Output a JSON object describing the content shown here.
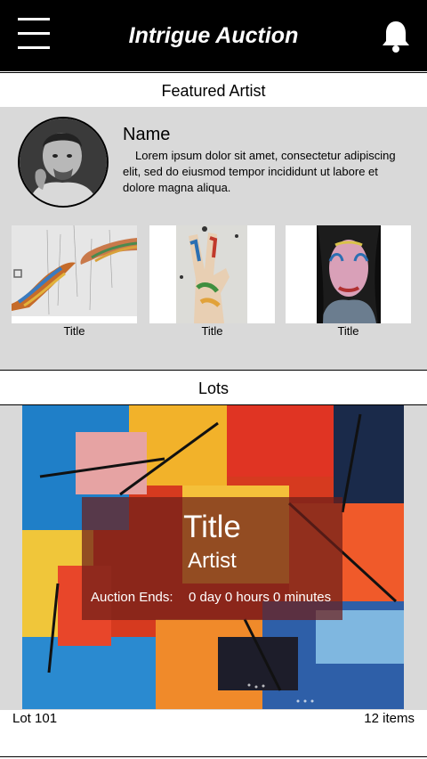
{
  "header": {
    "app_title": "Intrigue Auction",
    "menu_icon": "hamburger-menu-icon",
    "notification_icon": "bell-icon"
  },
  "featured_artist": {
    "section_label": "Featured Artist",
    "name": "Name",
    "bio": "Lorem ipsum dolor sit amet, consectetur adipiscing elit, sed do eiusmod tempor incididunt ut labore et dolore magna aliqua.",
    "artworks": [
      {
        "title": "Title"
      },
      {
        "title": "Title"
      },
      {
        "title": "Title"
      }
    ]
  },
  "lots": {
    "section_label": "Lots",
    "current_lot": {
      "title": "Title",
      "artist": "Artist",
      "auction_ends_label": "Auction Ends:",
      "auction_ends_value": "0 day 0 hours 0 minutes"
    },
    "lot_number": "Lot 101",
    "item_count": "12 items"
  },
  "colors": {
    "header_bg": "#000000",
    "panel_bg": "#d9d9d9",
    "overlay_bg": "#6e1e19"
  }
}
